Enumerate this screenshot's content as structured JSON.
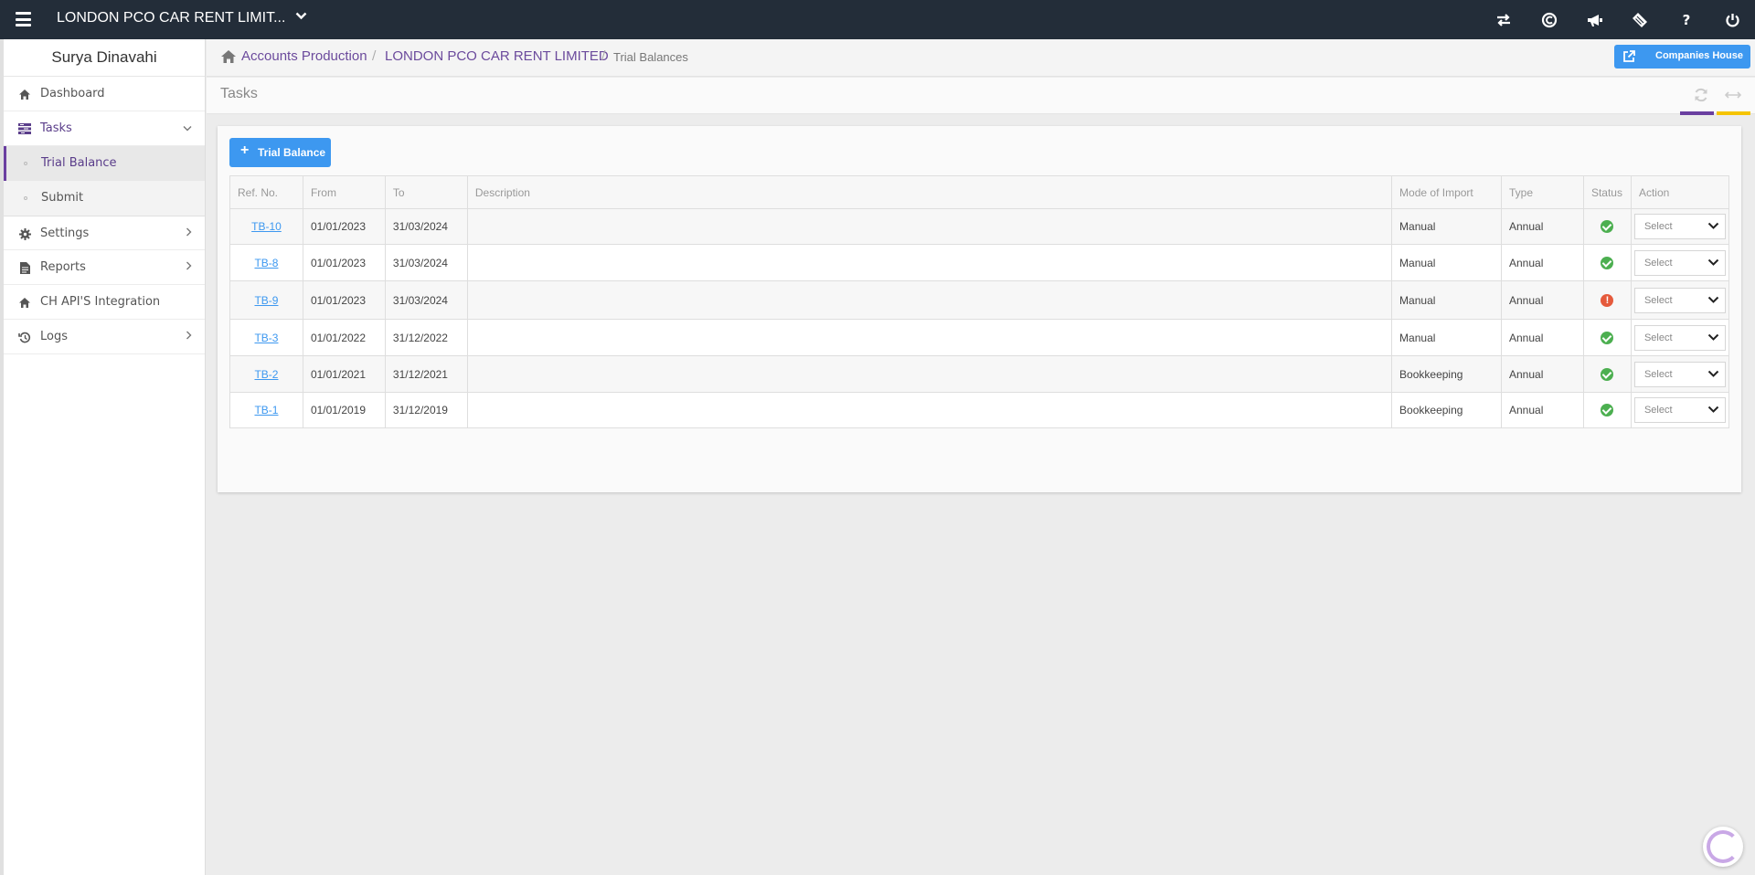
{
  "topbar": {
    "company_name": "LONDON PCO CAR RENT LIMIT...",
    "icons": [
      "hamburger-icon",
      "chevron-down-icon",
      "transfer-icon",
      "currency-icon",
      "megaphone-icon",
      "ticket-icon",
      "help-icon",
      "power-icon"
    ]
  },
  "sidebar": {
    "user_name": "Surya Dinavahi",
    "items": [
      {
        "label": "Dashboard",
        "icon": "home-icon"
      },
      {
        "label": "Tasks",
        "icon": "tasks-icon"
      },
      {
        "label": "Trial Balance"
      },
      {
        "label": "Submit"
      },
      {
        "label": "Settings",
        "icon": "gear-icon"
      },
      {
        "label": "Reports",
        "icon": "file-icon"
      },
      {
        "label": "CH API'S Integration",
        "icon": "home-icon"
      },
      {
        "label": "Logs",
        "icon": "history-icon"
      }
    ]
  },
  "breadcrumb": {
    "items": [
      "Accounts Production",
      "LONDON PCO CAR RENT LIMITED",
      "Trial Balances"
    ],
    "separator": "/",
    "companies_house_label": "Companies House"
  },
  "page": {
    "title": "Tasks",
    "add_button_label": "Trial Balance",
    "add_button_icon": "+",
    "accent_colors": {
      "primary": "#3d98f0",
      "purple": "#6a3fa0",
      "yellow": "#f5c400",
      "topbar": "#232d39"
    }
  },
  "table": {
    "headers": [
      "Ref. No.",
      "From",
      "To",
      "Description",
      "Mode of Import",
      "Type",
      "Status",
      "Action"
    ],
    "rows": [
      {
        "ref": "TB-10",
        "from": "01/01/2023",
        "to": "31/03/2024",
        "description": "",
        "mode": "Manual",
        "type": "Annual",
        "status": "ok",
        "action": "Select"
      },
      {
        "ref": "TB-8",
        "from": "01/01/2023",
        "to": "31/03/2024",
        "description": "",
        "mode": "Manual",
        "type": "Annual",
        "status": "ok",
        "action": "Select"
      },
      {
        "ref": "TB-9",
        "from": "01/01/2023",
        "to": "31/03/2024",
        "description": "",
        "mode": "Manual",
        "type": "Annual",
        "status": "error",
        "action": "Select"
      },
      {
        "ref": "TB-3",
        "from": "01/01/2022",
        "to": "31/12/2022",
        "description": "",
        "mode": "Manual",
        "type": "Annual",
        "status": "ok",
        "action": "Select"
      },
      {
        "ref": "TB-2",
        "from": "01/01/2021",
        "to": "31/12/2021",
        "description": "",
        "mode": "Bookkeeping",
        "type": "Annual",
        "status": "ok",
        "action": "Select"
      },
      {
        "ref": "TB-1",
        "from": "01/01/2019",
        "to": "31/12/2019",
        "description": "",
        "mode": "Bookkeeping",
        "type": "Annual",
        "status": "ok",
        "action": "Select"
      }
    ],
    "status_error_glyph": "!"
  }
}
